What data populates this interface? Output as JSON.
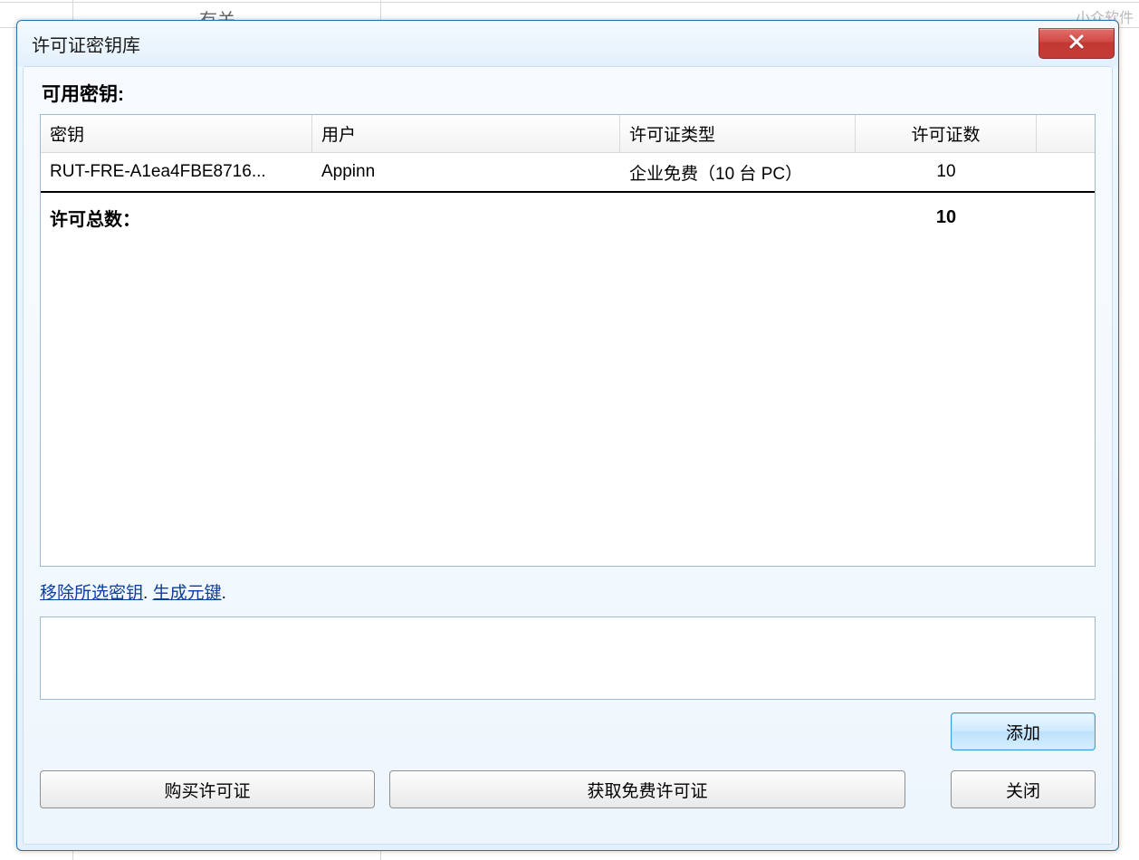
{
  "background": {
    "partial_text": "有关",
    "watermark": "小众软件"
  },
  "dialog": {
    "title": "许可证密钥库",
    "section_label": "可用密钥:",
    "table": {
      "headers": {
        "key": "密钥",
        "user": "用户",
        "type": "许可证类型",
        "count": "许可证数"
      },
      "rows": [
        {
          "key": "RUT-FRE-A1ea4FBE8716...",
          "user": "Appinn",
          "type": "企业免费（10 台 PC）",
          "count": "10"
        }
      ],
      "total_label": "许可总数：",
      "total_value": "10"
    },
    "links": {
      "remove": "移除所选密钥",
      "generate": "生成元键",
      "separator": ". ",
      "trailing": "."
    },
    "buttons": {
      "add": "添加",
      "buy": "购买许可证",
      "get_free": "获取免费许可证",
      "close": "关闭"
    }
  }
}
